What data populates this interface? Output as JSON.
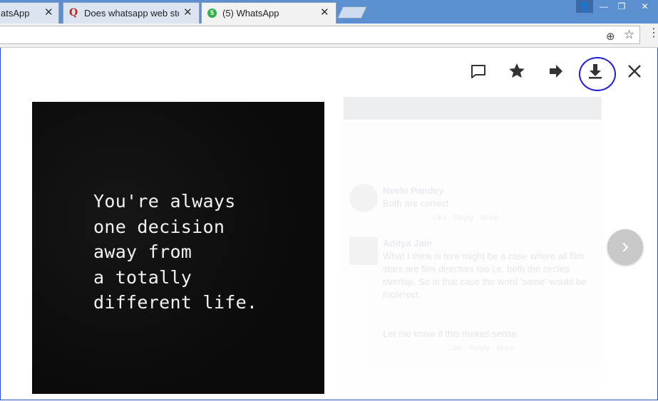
{
  "browser": {
    "tabs": [
      {
        "label": "atsApp",
        "close": "✕"
      },
      {
        "icon": "Q",
        "label": "Does whatsapp web stor",
        "close": "✕"
      },
      {
        "icon": "5",
        "label": "(5) WhatsApp",
        "close": "✕",
        "active": true
      }
    ],
    "window_controls": {
      "user": "👤",
      "minimize": "—",
      "maximize": "❐",
      "close": "✕"
    },
    "omnibox": {
      "zoom_icon": "⊕",
      "star_icon": "☆",
      "menu_icon": "⋮"
    }
  },
  "viewer": {
    "toolbar": {
      "reply_icon": "comment-icon",
      "star_icon": "star-icon",
      "forward_icon": "forward-arrow-icon",
      "download_icon": "download-icon",
      "close_icon": "close-icon"
    },
    "image": {
      "quote_lines": [
        "You're always",
        "one decision",
        "away from",
        "a totally",
        "different life."
      ]
    },
    "next_arrow": "›"
  },
  "background": {
    "comments": [
      {
        "name": "Neelu Pandey",
        "text": "Both are correct",
        "meta": "· Like · Reply · More"
      },
      {
        "name": "Aditya Jain",
        "text": "What I think is tere might be a case where all film stars are film directors too i.e. both the circles overlap. So in that case the word 'some' would be incorrect.",
        "meta": ""
      },
      {
        "name": "",
        "text": "Let me know if this makes sense",
        "meta": "· Like · Reply · More"
      }
    ]
  },
  "colors": {
    "accent": "#2a50c8",
    "annotation": "#1d1ddb",
    "tab_bar": "#5b8fd0"
  }
}
